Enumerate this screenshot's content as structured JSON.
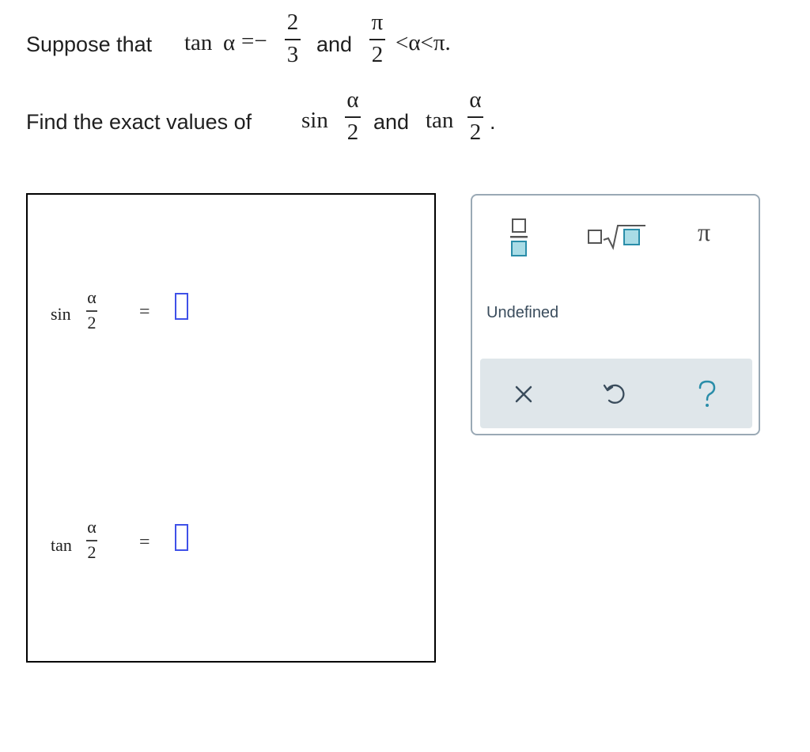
{
  "problem": {
    "line1_prefix": "Suppose that",
    "tan": "tan",
    "alpha": "α",
    "eq_minus": "=−",
    "num_2": "2",
    "den_3": "3",
    "and": "and",
    "pi": "π",
    "den_2": "2",
    "lt_alpha_lt_pi": "<α<π.",
    "line2_prefix": "Find the exact values of",
    "sin": "sin",
    "period": "."
  },
  "answers": [
    {
      "func": "sin",
      "num": "α",
      "den": "2",
      "equals": "="
    },
    {
      "func": "tan",
      "num": "α",
      "den": "2",
      "equals": "="
    }
  ],
  "toolbar": {
    "fraction_icon": "fraction-template-icon",
    "sqrt_icon": "sqrt-template-icon",
    "pi_label": "π",
    "undefined_label": "Undefined",
    "clear_icon": "close-icon",
    "undo_icon": "undo-icon",
    "help_icon": "help-icon",
    "accent": "#2a8da9",
    "frame": "#9aa9b5",
    "action_bg": "#dfe6ea"
  }
}
